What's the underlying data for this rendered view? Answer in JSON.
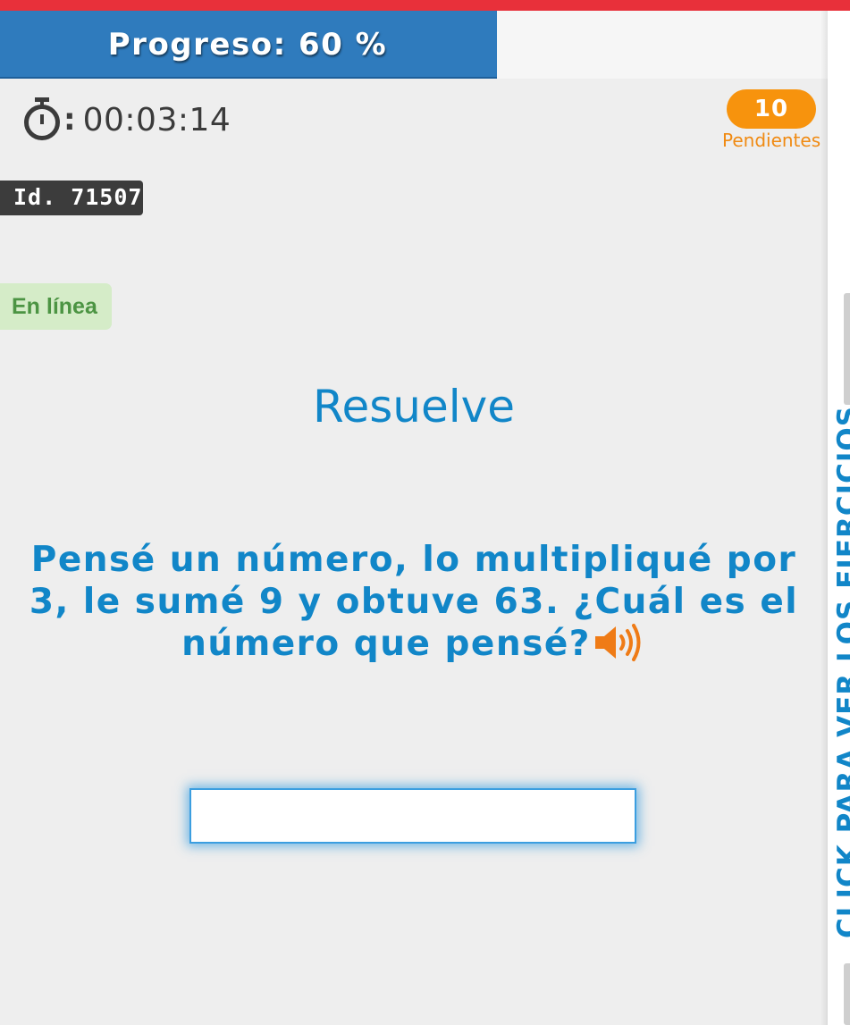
{
  "progress": {
    "label": "Progreso: 60 %",
    "fraction": 0.6
  },
  "timer": {
    "icon": "stopwatch-icon",
    "separator": ":",
    "value": "00:03:14"
  },
  "pending": {
    "count": "10",
    "label": "Pendientes"
  },
  "exercise_id": "Id. 71507",
  "status": "En línea",
  "heading": "Resuelve",
  "question": {
    "text": "Pensé un número, lo multipliqué por 3, le sumé 9 y obtuve 63. ¿Cuál es el número que pensé?",
    "audio_icon": "speaker-icon"
  },
  "answer": {
    "value": "",
    "placeholder": ""
  },
  "side_panel": {
    "label": "CLICK PARA VER LOS EJERCICIOS"
  },
  "colors": {
    "accent_blue": "#1186c8",
    "progress_blue": "#2f7bbd",
    "top_red": "#e8303a",
    "pending_orange": "#f7930d",
    "online_green": "#4c9443",
    "speaker_orange": "#ef7b16"
  }
}
